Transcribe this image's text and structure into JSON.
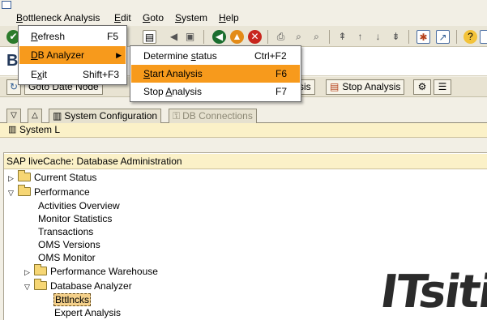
{
  "menubar": {
    "items": [
      {
        "label": "Bottleneck Analysis",
        "accel": "B"
      },
      {
        "label": "Edit",
        "accel": "E"
      },
      {
        "label": "Goto",
        "accel": "G"
      },
      {
        "label": "System",
        "accel": "S"
      },
      {
        "label": "Help",
        "accel": "H"
      }
    ]
  },
  "title": {
    "text": "B"
  },
  "apptoolbar": {
    "goto_date_node": "Goto Date Node",
    "partial_label": "sis",
    "stop_analysis": "Stop Analysis"
  },
  "tabs": {
    "system_configuration": "System Configuration",
    "db_connections": "DB Connections"
  },
  "system_line": {
    "text": "System L"
  },
  "tree": {
    "header": "SAP liveCache: Database Administration",
    "items": {
      "current_status": "Current Status",
      "performance": "Performance",
      "activities_overview": "Activities Overview",
      "monitor_statistics": "Monitor Statistics",
      "transactions": "Transactions",
      "oms_versions": "OMS Versions",
      "oms_monitor": "OMS Monitor",
      "performance_warehouse": "Performance Warehouse",
      "database_analyzer": "Database Analyzer",
      "bttlncks": "Bttlncks",
      "expert_analysis": "Expert Analysis"
    }
  },
  "dropdown": {
    "refresh": {
      "label": "Refresh",
      "accel": "R",
      "shortcut": "F5"
    },
    "db_analyzer": {
      "label": "DB Analyzer",
      "accel": "D"
    },
    "exit": {
      "label": "Exit",
      "accel": "x",
      "shortcut": "Shift+F3"
    }
  },
  "submenu": {
    "determine_status": {
      "label": "Determine status",
      "shortcut": "Ctrl+F2"
    },
    "start_analysis": {
      "label": "Start Analysis",
      "shortcut": "F6"
    },
    "stop_analysis": {
      "label": "Stop Analysis",
      "shortcut": "F7"
    }
  },
  "watermark": {
    "text": "ITsiti"
  },
  "colors": {
    "highlight": "#f79a1c",
    "header_yellow": "#fbf1c8",
    "background": "#f2efe5"
  }
}
